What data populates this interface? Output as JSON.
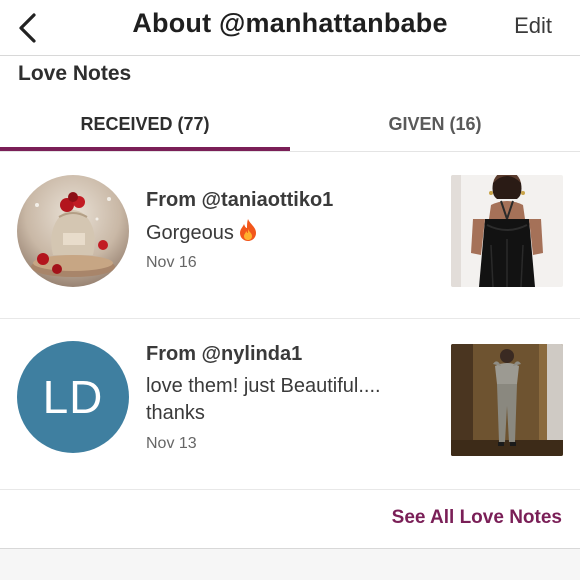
{
  "header": {
    "title": "About @manhattanbabe",
    "edit_label": "Edit",
    "back_icon": "chevron-left-icon"
  },
  "section": {
    "title": "Love Notes"
  },
  "tabs": [
    {
      "label": "RECEIVED (77)",
      "active": true
    },
    {
      "label": "GIVEN (16)",
      "active": false
    }
  ],
  "notes": [
    {
      "from": "From @taniaottiko1",
      "message": "Gorgeous",
      "emoji": "fire-icon",
      "date": "Nov 16",
      "avatar": "holiday-ornaments-photo"
    },
    {
      "from": "From @nylinda1",
      "message_line1": "love them! just Beautiful....",
      "message_line2": "thanks",
      "date": "Nov 13",
      "avatar_initials": "LD"
    }
  ],
  "see_all_label": "See All Love Notes",
  "colors": {
    "accent": "#7a1f57",
    "avatar_bg": "#3f7fa0"
  }
}
